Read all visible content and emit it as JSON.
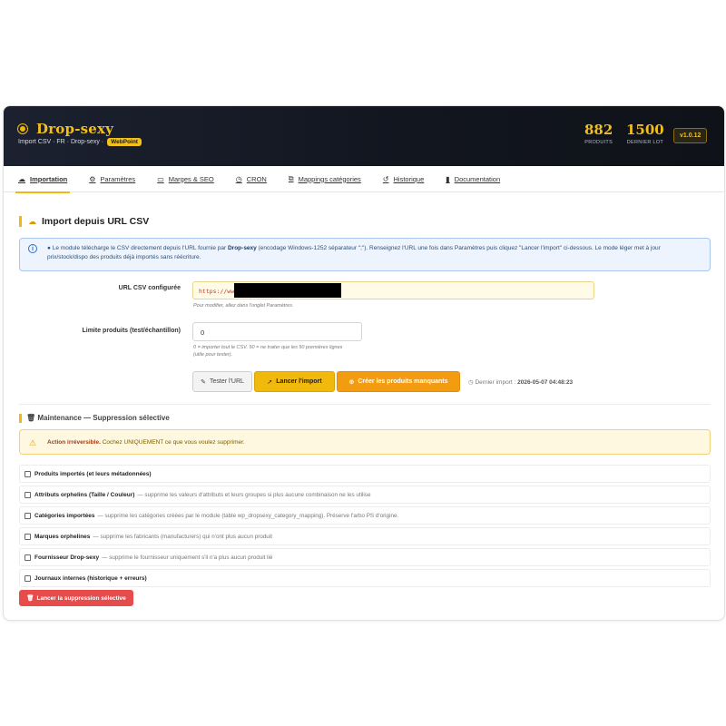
{
  "header": {
    "title": "Drop-sexy",
    "subtitle": "Import CSV · FR · Drop-sexy ·",
    "badge": "WebPoint",
    "stats": [
      {
        "value": "882",
        "label": "PRODUITS"
      },
      {
        "value": "1500",
        "label": "DERNIER LOT"
      }
    ],
    "version": "v1.0.12",
    "brand_color": "#f2bf1d"
  },
  "tabs": [
    {
      "icon": "cloud-upload-icon",
      "glyph": "☁",
      "label": "Importation",
      "active": true
    },
    {
      "icon": "gear-icon",
      "glyph": "⚙",
      "label": "Paramètres"
    },
    {
      "icon": "money-icon",
      "glyph": "▭",
      "label": "Marges & SEO"
    },
    {
      "icon": "clock-icon",
      "glyph": "◷",
      "label": "CRON"
    },
    {
      "icon": "sitemap-icon",
      "glyph": "⧉",
      "label": "Mappings catégories"
    },
    {
      "icon": "history-icon",
      "glyph": "↺",
      "label": "Historique"
    },
    {
      "icon": "book-icon",
      "glyph": "▮",
      "label": "Documentation"
    }
  ],
  "import": {
    "title": "Import depuis URL CSV",
    "info_prefix": "Le module télécharge le CSV directement depuis l'URL fournie par",
    "info_brand": "Drop-sexy",
    "info_suffix": "(encodage Windows-1252 séparateur \";\"). Renseignez l'URL une fois dans Paramètres puis cliquez \"Lancer l'import\" ci-dessous. Le mode léger met à jour prix/stock/dispo des produits déjà importés sans réécriture.",
    "url_label": "URL CSV configurée",
    "url_value": "https://www",
    "url_help": "Pour modifier, allez dans l'onglet Paramètres.",
    "limit_label": "Limite produits (test/échantillon)",
    "limit_value": "0",
    "limit_help_1": "0 = importer tout le CSV. 50 = ne traiter que les 50 premières lignes",
    "limit_help_2": "(utile pour tester).",
    "btn_test": "Tester l'URL",
    "btn_launch": "Lancer l'import",
    "btn_create": "Créer les produits manquants",
    "last_import_label": "Dernier import :",
    "last_import_value": "2026-05-07 04:48:23"
  },
  "maintenance": {
    "title": "Maintenance — Suppression sélective",
    "warning_strong": "Action irréversible.",
    "warning_text": "Cochez UNIQUEMENT ce que vous voulez supprimer.",
    "options": [
      {
        "label": "Produits importés (et leurs métadonnées)",
        "desc": ""
      },
      {
        "label": "Attributs orphelins (Taille / Couleur)",
        "desc": "— supprime les valeurs d'attributs et leurs groupes si plus aucune combinaison ne les utilise"
      },
      {
        "label": "Catégories importées",
        "desc": "— supprime les catégories créées par le module (table wp_dropsexy_category_mapping). Préserve l'arbo PS d'origine."
      },
      {
        "label": "Marques orphelines",
        "desc": "— supprime les fabricants (manufacturers) qui n'ont plus aucun produit"
      },
      {
        "label": "Fournisseur Drop-sexy",
        "desc": "— supprime le fournisseur uniquement s'il n'a plus aucun produit lié"
      },
      {
        "label": "Journaux internes (historique + erreurs)",
        "desc": ""
      }
    ],
    "btn_delete": "Lancer la suppression sélective"
  }
}
